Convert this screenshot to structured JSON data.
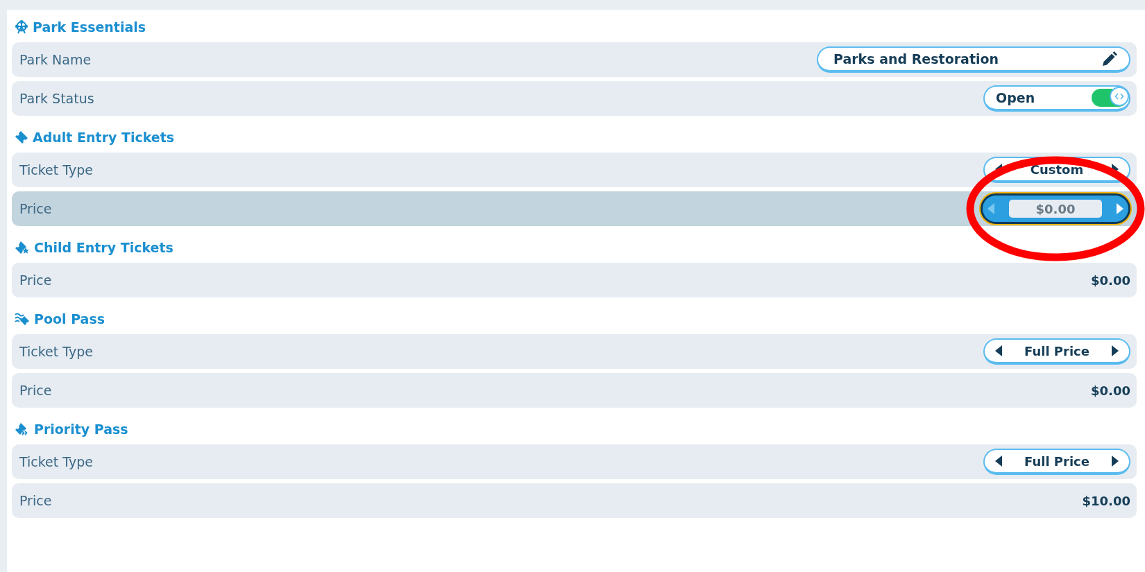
{
  "sections": [
    {
      "title": "Park Essentials",
      "rows": [
        {
          "kind": "text-field",
          "label": "Park Name",
          "value": "Parks and Restoration",
          "selected": false,
          "circled": false
        },
        {
          "kind": "toggle",
          "label": "Park Status",
          "value": "Open",
          "on": true,
          "selected": false,
          "circled": false
        }
      ]
    },
    {
      "title": "Adult Entry Tickets",
      "rows": [
        {
          "kind": "selector",
          "label": "Ticket Type",
          "value": "Custom",
          "selected": false,
          "circled": false
        },
        {
          "kind": "stepper",
          "label": "Price",
          "value": "$0.00",
          "selected": true,
          "circled": true
        }
      ]
    },
    {
      "title": "Child Entry Tickets",
      "rows": [
        {
          "kind": "value",
          "label": "Price",
          "value": "$0.00",
          "selected": false,
          "circled": false
        }
      ]
    },
    {
      "title": "Pool Pass",
      "rows": [
        {
          "kind": "selector",
          "label": "Ticket Type",
          "value": "Full Price",
          "selected": false,
          "circled": false
        },
        {
          "kind": "value",
          "label": "Price",
          "value": "$0.00",
          "selected": false,
          "circled": false
        }
      ]
    },
    {
      "title": "Priority Pass",
      "rows": [
        {
          "kind": "selector",
          "label": "Ticket Type",
          "value": "Full Price",
          "selected": false,
          "circled": false
        },
        {
          "kind": "value",
          "label": "Price",
          "value": "$10.00",
          "selected": false,
          "circled": false
        }
      ]
    }
  ]
}
